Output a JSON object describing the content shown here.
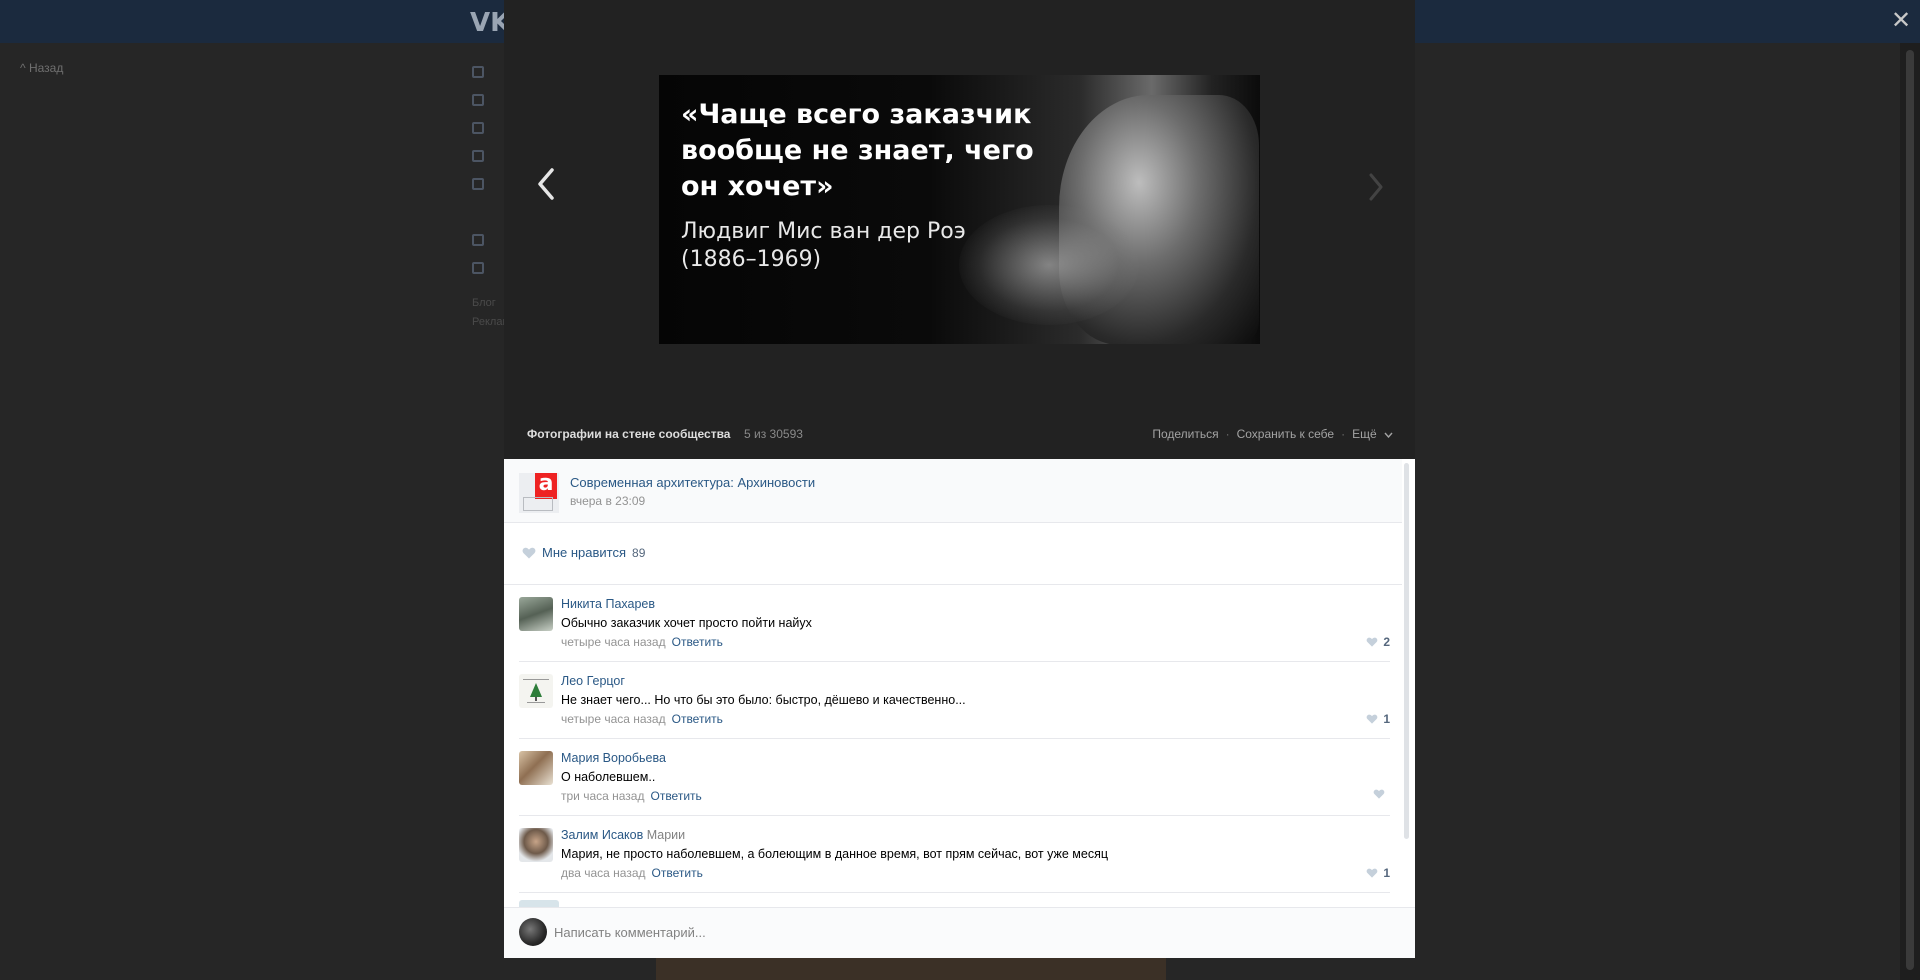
{
  "background": {
    "logo": "VK",
    "back_label": "Назад",
    "footer_links": [
      "Блог",
      "Реклама"
    ]
  },
  "viewer": {
    "photo": {
      "quote": "«Чаще всего заказчик вообще не знает, чего он хочет»",
      "author": "Людвиг Мис ван дер Роэ (1886–1969)"
    },
    "album_title": "Фотографии на стене сообщества",
    "counter": "5 из 30593",
    "actions": {
      "share": "Поделиться",
      "save": "Сохранить к себе",
      "more": "Ещё"
    }
  },
  "owner": {
    "name": "Современная архитектура: Архиновости",
    "time": "вчера в 23:09"
  },
  "likes": {
    "label": "Мне нравится",
    "count": "89"
  },
  "comments": [
    {
      "author": "Никита Пахарев",
      "reply_to": "",
      "text": "Обычно заказчик хочет просто пойти найух",
      "time": "четыре часа назад",
      "reply_label": "Ответить",
      "likes": "2"
    },
    {
      "author": "Лео Герцог",
      "reply_to": "",
      "text": "Не знает чего... Но что бы это было: быстро, дёшево и качественно...",
      "time": "четыре часа назад",
      "reply_label": "Ответить",
      "likes": "1"
    },
    {
      "author": "Мария Воробьева",
      "reply_to": "",
      "text": "О наболевшем..",
      "time": "три часа назад",
      "reply_label": "Ответить",
      "likes": ""
    },
    {
      "author": "Залим Исаков",
      "reply_to": "Марии",
      "text": "Мария, не просто наболевшем, а болеющим в данное время, вот прям сейчас, вот уже месяц",
      "time": "два часа назад",
      "reply_label": "Ответить",
      "likes": "1"
    }
  ],
  "compose": {
    "placeholder": "Написать комментарий..."
  },
  "colors": {
    "link": "#2a5885",
    "muted": "#939393",
    "overlay": "#262626"
  }
}
